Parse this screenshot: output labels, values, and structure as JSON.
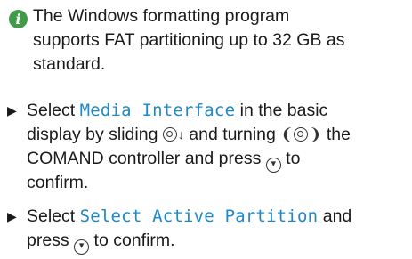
{
  "note": {
    "icon": "info-icon",
    "icon_glyph": "i",
    "icon_color": "#3f9b47",
    "lines": [
      "The Windows formatting program",
      "supports FAT partitioning up to 32 GB as",
      "standard."
    ]
  },
  "steps": [
    {
      "bullet": "▶",
      "line1_pre": "Select ",
      "line1_highlight": "Media Interface",
      "line1_post": " in the basic",
      "line2_pre": "display by sliding ",
      "line2_mid": " and turning ",
      "line2_post": " the",
      "line3_pre": "COMAND controller and press ",
      "line3_post": " to",
      "line4": "confirm."
    },
    {
      "bullet": "▶",
      "line1_pre": "Select ",
      "line1_highlight": "Select Active Partition",
      "line1_post": " and",
      "line2_pre": "press ",
      "line2_post": " to confirm."
    }
  ],
  "colors": {
    "highlight": "#1e88c8",
    "text": "#1a1a1a"
  }
}
